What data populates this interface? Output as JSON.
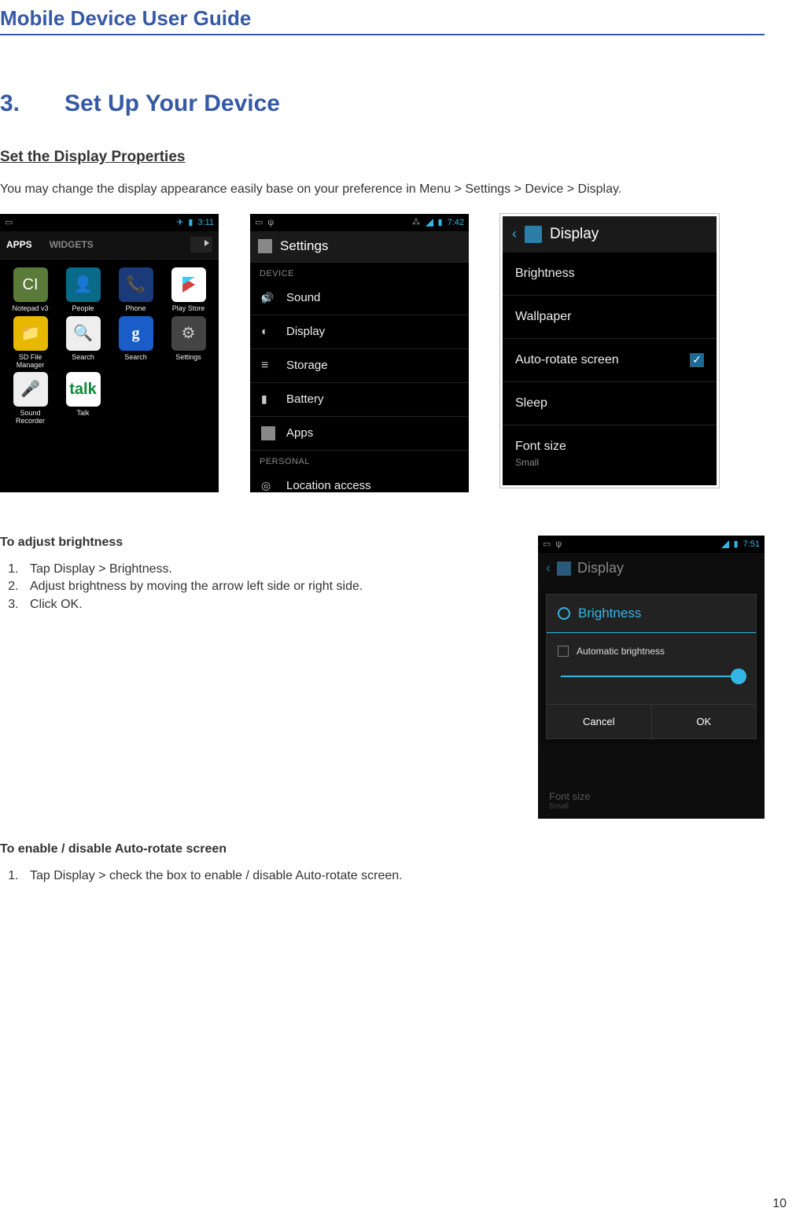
{
  "header": "Mobile Device User Guide",
  "section": {
    "number": "3.",
    "title": "Set Up Your Device"
  },
  "sub1": "Set the Display Properties",
  "intro": "You may change the display appearance easily base on your preference in Menu > Settings > Device > Display.",
  "shot1": {
    "time": "3:11",
    "tabs": {
      "apps": "APPS",
      "widgets": "WIDGETS"
    },
    "apps": [
      {
        "label": "Notepad v3"
      },
      {
        "label": "People"
      },
      {
        "label": "Phone"
      },
      {
        "label": "Play Store"
      },
      {
        "label": "SD File Manager"
      },
      {
        "label": "Search"
      },
      {
        "label": "Search"
      },
      {
        "label": "Settings"
      },
      {
        "label": "Sound Recorder"
      },
      {
        "label": "Talk"
      }
    ]
  },
  "shot2": {
    "time": "7:42",
    "title": "Settings",
    "section_device": "DEVICE",
    "rows": [
      "Sound",
      "Display",
      "Storage",
      "Battery",
      "Apps"
    ],
    "section_personal": "PERSONAL",
    "row_personal": "Location access"
  },
  "shot3": {
    "title": "Display",
    "rows": {
      "brightness": "Brightness",
      "wallpaper": "Wallpaper",
      "autorotate": "Auto-rotate screen",
      "sleep": "Sleep",
      "fontsize": "Font size",
      "fontsize_sub": "Small"
    }
  },
  "adjust": {
    "heading": "To adjust brightness",
    "steps": [
      "Tap Display > Brightness.",
      "Adjust brightness by moving the arrow left side or right side.",
      "Click OK."
    ]
  },
  "shot4": {
    "time": "7:51",
    "header": "Display",
    "dialog": {
      "title": "Brightness",
      "auto": "Automatic brightness",
      "cancel": "Cancel",
      "ok": "OK"
    },
    "faint": "Font size",
    "faint_sub": "Small"
  },
  "autorotate": {
    "heading": "To enable / disable Auto-rotate screen",
    "steps": [
      "Tap Display > check the box to enable / disable Auto-rotate screen."
    ]
  },
  "page_number": "10"
}
